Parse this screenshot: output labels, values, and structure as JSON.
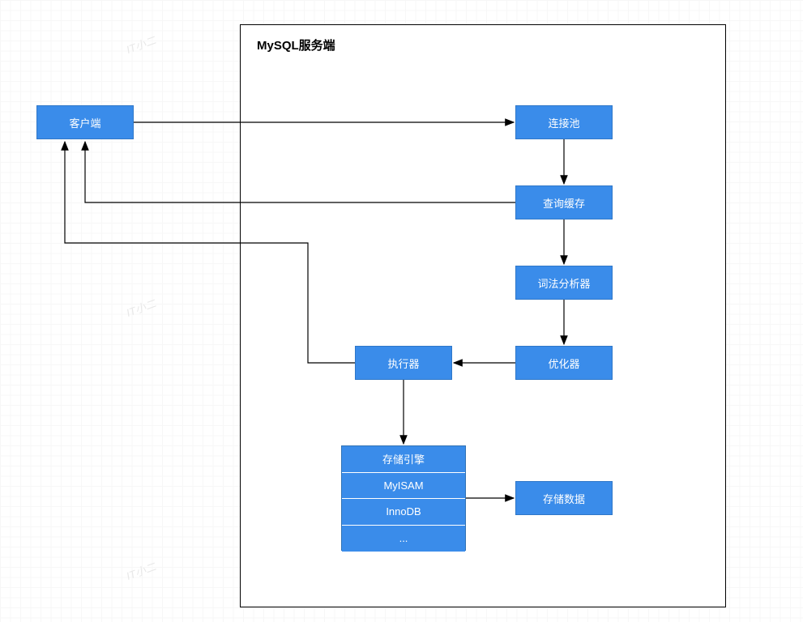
{
  "watermark_text": "IT小二",
  "server": {
    "title": "MySQL服务端"
  },
  "nodes": {
    "client": "客户端",
    "pool": "连接池",
    "cache": "查询缓存",
    "lexer": "词法分析器",
    "optimizer": "优化器",
    "executor": "执行器",
    "storage_data": "存储数据"
  },
  "engine": {
    "header": "存储引擎",
    "rows": [
      "MyISAM",
      "InnoDB",
      "..."
    ]
  }
}
